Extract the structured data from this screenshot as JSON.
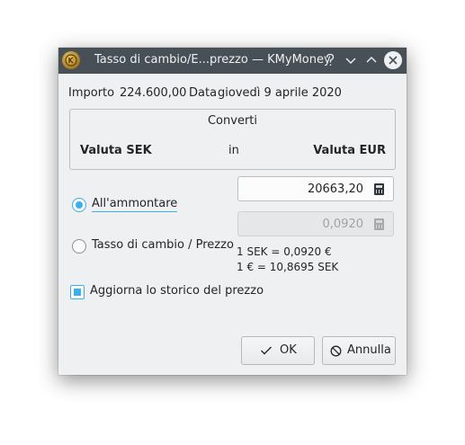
{
  "window": {
    "title": "Tasso di cambio/E...prezzo — KMyMoney",
    "icons": [
      "kmymoney-app-icon",
      "help-icon",
      "minimize-icon",
      "maximize-icon",
      "close-icon"
    ]
  },
  "info": {
    "amount_label": "Importo",
    "amount_value": "224.600,00",
    "date_label": "Data",
    "date_value": "giovedì 9 aprile 2020"
  },
  "convert": {
    "title": "Converti",
    "from": "Valuta SEK",
    "in": "in",
    "to": "Valuta EUR"
  },
  "options": {
    "amount_radio": "All'ammontare",
    "amount_value": "20663,20",
    "rate_radio": "Tasso di cambio / Prezzo",
    "rate_value": "0,0920",
    "rate_line1": "1 SEK = 0,0920 €",
    "rate_line2": "1 € = 10,8695 SEK",
    "selected": "amount"
  },
  "update_history": {
    "label": "Aggiorna lo storico del prezzo",
    "checked": true
  },
  "buttons": {
    "ok": "OK",
    "cancel": "Annulla"
  },
  "colors": {
    "accent": "#3daee9",
    "titlebar": "#475057",
    "window_bg": "#eff0f1"
  }
}
